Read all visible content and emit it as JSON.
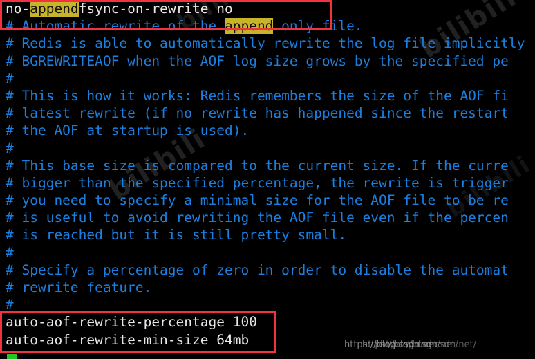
{
  "terminal": {
    "background_color": "#000000",
    "comment_color": "#1b7fe0",
    "directive_color": "#e8e8e8",
    "highlight_background": "#c8b42a",
    "highlight_color": "#101010",
    "annotation_box_color": "#f2333f",
    "cursor_color": "#23c723"
  },
  "lines": [
    {
      "kind": "directive",
      "segments": [
        {
          "text": "no-"
        },
        {
          "text": "append",
          "highlight": true
        },
        {
          "text": "fsync-on-rewrite no"
        }
      ]
    },
    {
      "kind": "comment",
      "segments": [
        {
          "text": "# Automatic rewrite of the "
        },
        {
          "text": "append",
          "highlight": true
        },
        {
          "text": " only file."
        }
      ]
    },
    {
      "kind": "comment",
      "segments": [
        {
          "text": "# Redis is able to automatically rewrite the log file implicitly"
        }
      ]
    },
    {
      "kind": "comment",
      "segments": [
        {
          "text": "# BGREWRITEAOF when the AOF log size grows by the specified pe"
        }
      ]
    },
    {
      "kind": "comment",
      "segments": [
        {
          "text": "#"
        }
      ]
    },
    {
      "kind": "comment",
      "segments": [
        {
          "text": "# This is how it works: Redis remembers the size of the AOF fi"
        }
      ]
    },
    {
      "kind": "comment",
      "segments": [
        {
          "text": "# latest rewrite (if no rewrite has happened since the restart"
        }
      ]
    },
    {
      "kind": "comment",
      "segments": [
        {
          "text": "# the AOF at startup is used)."
        }
      ]
    },
    {
      "kind": "comment",
      "segments": [
        {
          "text": "#"
        }
      ]
    },
    {
      "kind": "comment",
      "segments": [
        {
          "text": "# This base size is compared to the current size. If the curre"
        }
      ]
    },
    {
      "kind": "comment",
      "segments": [
        {
          "text": "# bigger than the specified percentage, the rewrite is trigger"
        }
      ]
    },
    {
      "kind": "comment",
      "segments": [
        {
          "text": "# you need to specify a minimal size for the AOF file to be re"
        }
      ]
    },
    {
      "kind": "comment",
      "segments": [
        {
          "text": "# is useful to avoid rewriting the AOF file even if the percen"
        }
      ]
    },
    {
      "kind": "comment",
      "segments": [
        {
          "text": "# is reached but it is still pretty small."
        }
      ]
    },
    {
      "kind": "comment",
      "segments": [
        {
          "text": "#"
        }
      ]
    },
    {
      "kind": "comment",
      "segments": [
        {
          "text": "# Specify a percentage of zero in order to disable the automat"
        }
      ]
    },
    {
      "kind": "comment",
      "segments": [
        {
          "text": "# rewrite feature."
        }
      ]
    },
    {
      "kind": "comment",
      "segments": [
        {
          "text": "#"
        }
      ]
    },
    {
      "kind": "directive",
      "segments": [
        {
          "text": "auto-aof-rewrite-percentage 100"
        }
      ]
    },
    {
      "kind": "directive",
      "segments": [
        {
          "text": "auto-aof-rewrite-min-size 64mb"
        }
      ]
    }
  ],
  "annotations": {
    "top_box_label": "no-appendfsync-on-rewrite no",
    "bottom_box_label": "auto-aof-rewrite-percentage 100 / auto-aof-rewrite-min-size 64mb"
  },
  "watermarks": {
    "background_text": "bilibili",
    "url_overlay": "https://blog.csdn.net/"
  }
}
